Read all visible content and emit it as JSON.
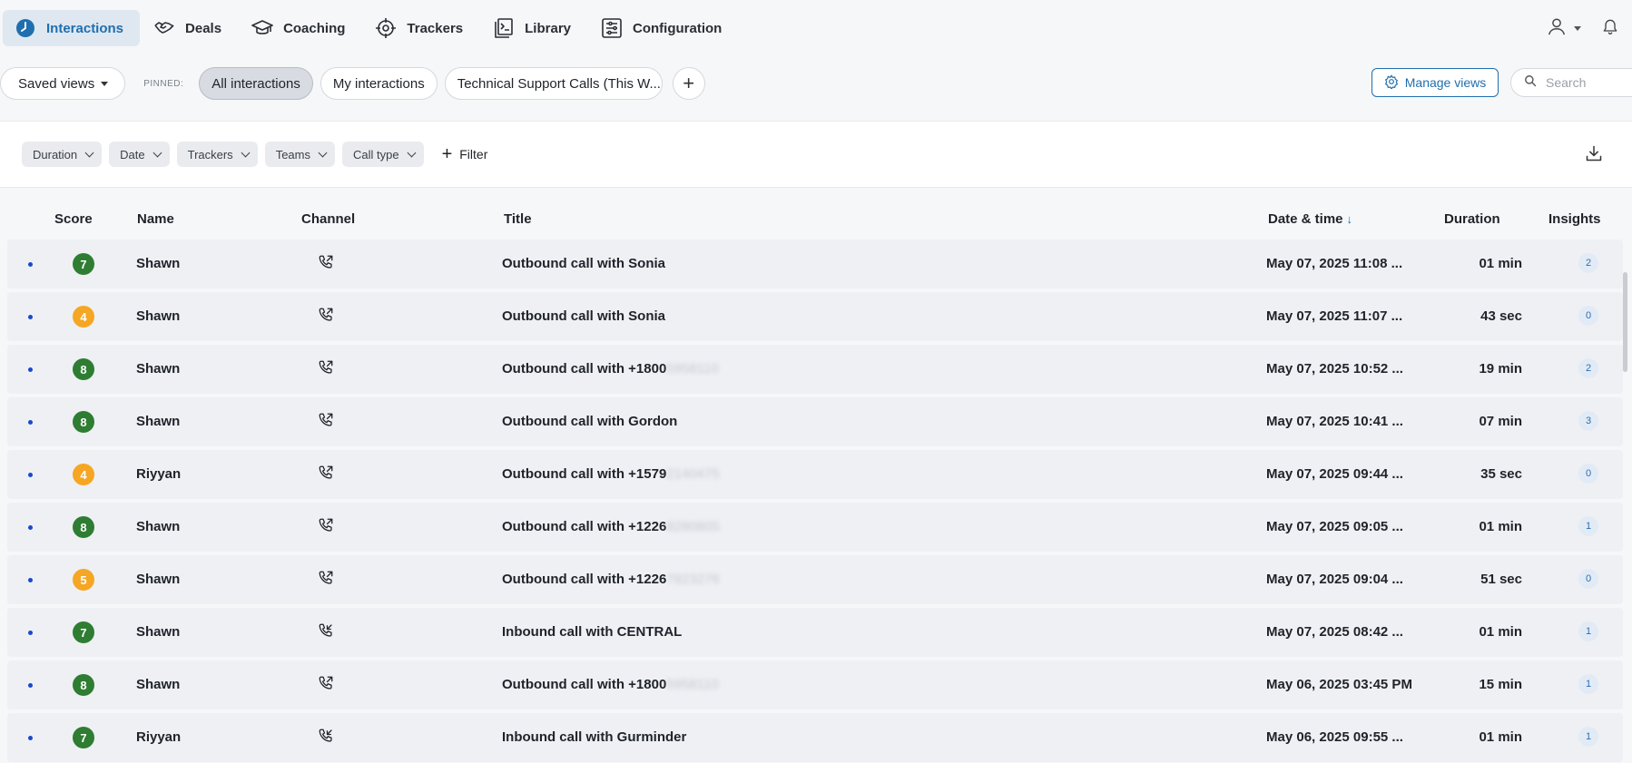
{
  "nav": {
    "items": [
      {
        "label": "Interactions",
        "icon": "clock-icon",
        "active": true
      },
      {
        "label": "Deals",
        "icon": "handshake-icon",
        "active": false
      },
      {
        "label": "Coaching",
        "icon": "graduation-cap-icon",
        "active": false
      },
      {
        "label": "Trackers",
        "icon": "crosshair-icon",
        "active": false
      },
      {
        "label": "Library",
        "icon": "library-icon",
        "active": false
      },
      {
        "label": "Configuration",
        "icon": "configuration-icon",
        "active": false
      }
    ]
  },
  "views": {
    "saved_label": "Saved views",
    "pinned_label": "PINNED:",
    "pinned": [
      "All interactions",
      "My interactions",
      "Technical Support Calls (This W..."
    ],
    "active_index": 0,
    "add_label": "+",
    "manage_label": "Manage views",
    "search_placeholder": "Search"
  },
  "filters": {
    "chips": [
      "Duration",
      "Date",
      "Trackers",
      "Teams",
      "Call type"
    ],
    "add_label": "Filter"
  },
  "table": {
    "headers": {
      "score": "Score",
      "name": "Name",
      "channel": "Channel",
      "title": "Title",
      "datetime": "Date & time",
      "duration": "Duration",
      "insights": "Insights"
    },
    "sort_arrow": "↓",
    "rows": [
      {
        "score": "7",
        "name": "Shawn",
        "direction": "outbound",
        "title": "Outbound call with Sonia",
        "title_hidden": "",
        "datetime": "May 07, 2025 11:08 ...",
        "duration": "01 min",
        "insights": "2"
      },
      {
        "score": "4",
        "name": "Shawn",
        "direction": "outbound",
        "title": "Outbound call with Sonia",
        "title_hidden": "",
        "datetime": "May 07, 2025 11:07 ...",
        "duration": "43 sec",
        "insights": "0"
      },
      {
        "score": "8",
        "name": "Shawn",
        "direction": "outbound",
        "title": "Outbound call with +1800",
        "title_hidden": "5958110",
        "datetime": "May 07, 2025 10:52 ...",
        "duration": "19 min",
        "insights": "2"
      },
      {
        "score": "8",
        "name": "Shawn",
        "direction": "outbound",
        "title": "Outbound call with Gordon",
        "title_hidden": "",
        "datetime": "May 07, 2025 10:41 ...",
        "duration": "07 min",
        "insights": "3"
      },
      {
        "score": "4",
        "name": "Riyyan",
        "direction": "outbound",
        "title": "Outbound call with +1579",
        "title_hidden": "2140475",
        "datetime": "May 07, 2025 09:44 ...",
        "duration": "35 sec",
        "insights": "0"
      },
      {
        "score": "8",
        "name": "Shawn",
        "direction": "outbound",
        "title": "Outbound call with +1226",
        "title_hidden": "8280805",
        "datetime": "May 07, 2025 09:05 ...",
        "duration": "01 min",
        "insights": "1"
      },
      {
        "score": "5",
        "name": "Shawn",
        "direction": "outbound",
        "title": "Outbound call with +1226",
        "title_hidden": "7823276",
        "datetime": "May 07, 2025 09:04 ...",
        "duration": "51 sec",
        "insights": "0"
      },
      {
        "score": "7",
        "name": "Shawn",
        "direction": "inbound",
        "title": "Inbound call with CENTRAL",
        "title_hidden": "",
        "datetime": "May 07, 2025 08:42 ...",
        "duration": "01 min",
        "insights": "1"
      },
      {
        "score": "8",
        "name": "Shawn",
        "direction": "outbound",
        "title": "Outbound call with +1800",
        "title_hidden": "5958110",
        "datetime": "May 06, 2025 03:45 PM",
        "duration": "15 min",
        "insights": "1"
      },
      {
        "score": "7",
        "name": "Riyyan",
        "direction": "inbound",
        "title": "Inbound call with Gurminder",
        "title_hidden": "",
        "datetime": "May 06, 2025 09:55 ...",
        "duration": "01 min",
        "insights": "1"
      }
    ]
  },
  "colors": {
    "accent": "#1f6fae",
    "score_high": "#2e7d32",
    "score_mid": "#f5a623"
  }
}
